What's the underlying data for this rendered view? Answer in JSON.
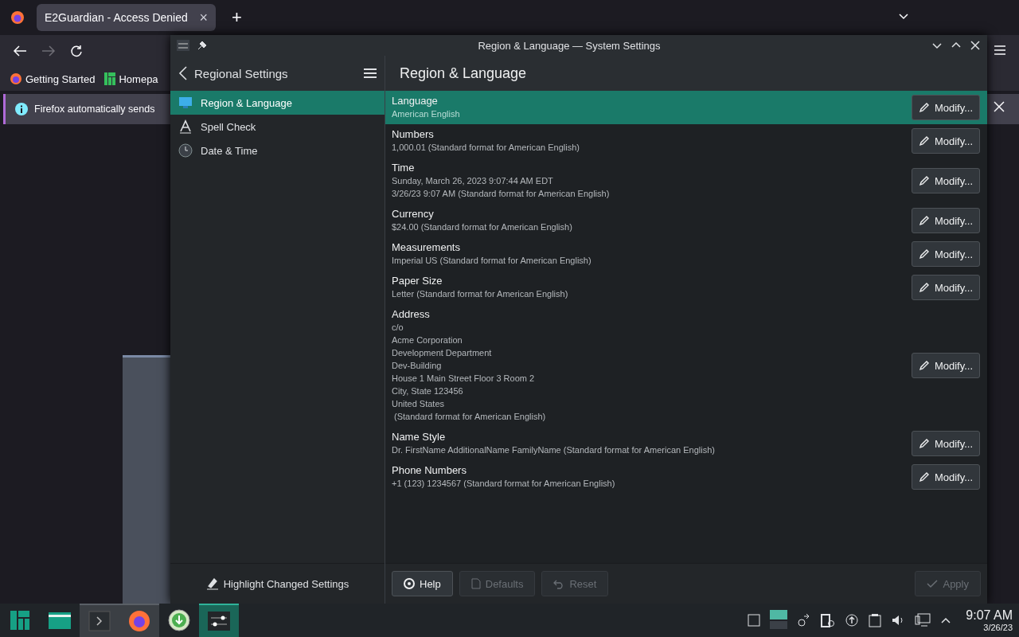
{
  "browser": {
    "tab": {
      "title": "E2Guardian - Access Denied",
      "close": "×"
    },
    "new_tab": "+",
    "bookmarks": [
      {
        "label": "Getting Started"
      },
      {
        "label": "Homepa"
      }
    ],
    "notification": {
      "text": "Firefox automatically sends"
    }
  },
  "settings_window": {
    "title": "Region & Language — System Settings",
    "sidebar": {
      "title": "Regional Settings",
      "items": [
        {
          "label": "Region & Language",
          "selected": true
        },
        {
          "label": "Spell Check",
          "selected": false
        },
        {
          "label": "Date & Time",
          "selected": false
        }
      ],
      "highlight_button": "Highlight Changed Settings"
    },
    "page": {
      "title": "Region & Language",
      "rows": [
        {
          "title": "Language",
          "lines": [
            "American English"
          ],
          "selected": true,
          "button": "Modify..."
        },
        {
          "title": "Numbers",
          "lines": [
            "1,000.01 (Standard format for American English)"
          ],
          "selected": false,
          "button": "Modify..."
        },
        {
          "title": "Time",
          "lines": [
            "Sunday, March 26, 2023 9:07:44 AM EDT",
            "3/26/23 9:07 AM (Standard format for American English)"
          ],
          "selected": false,
          "button": "Modify..."
        },
        {
          "title": "Currency",
          "lines": [
            "$24.00 (Standard format for American English)"
          ],
          "selected": false,
          "button": "Modify..."
        },
        {
          "title": "Measurements",
          "lines": [
            "Imperial US (Standard format for American English)"
          ],
          "selected": false,
          "button": "Modify..."
        },
        {
          "title": "Paper Size",
          "lines": [
            "Letter (Standard format for American English)"
          ],
          "selected": false,
          "button": "Modify..."
        },
        {
          "title": "Address",
          "lines": [
            "c/o",
            "Acme Corporation",
            "Development Department",
            "Dev-Building",
            "House 1 Main Street Floor 3 Room 2",
            "City, State 123456",
            "United States",
            " (Standard format for American English)"
          ],
          "selected": false,
          "button": "Modify..."
        },
        {
          "title": "Name Style",
          "lines": [
            "Dr. FirstName AdditionalName FamilyName (Standard format for American English)"
          ],
          "selected": false,
          "button": "Modify..."
        },
        {
          "title": "Phone Numbers",
          "lines": [
            "+1 (123) 1234567 (Standard format for American English)"
          ],
          "selected": false,
          "button": "Modify..."
        }
      ]
    },
    "buttons": [
      {
        "label": "Help",
        "disabled": false
      },
      {
        "label": "Defaults",
        "disabled": true
      },
      {
        "label": "Reset",
        "disabled": true
      },
      {
        "label": "Apply",
        "disabled": true
      }
    ]
  },
  "taskbar": {
    "apps": [
      {
        "open": false,
        "selected": false
      },
      {
        "open": false,
        "selected": false
      },
      {
        "open": true,
        "selected": false
      },
      {
        "open": true,
        "selected": false
      },
      {
        "open": false,
        "selected": false
      },
      {
        "open": true,
        "selected": true
      }
    ],
    "clock": {
      "time": "9:07 AM",
      "date": "3/26/23"
    }
  }
}
